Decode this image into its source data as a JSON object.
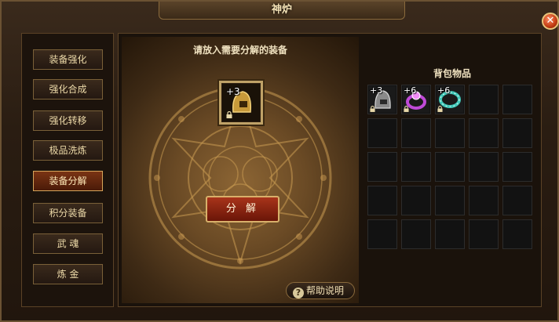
{
  "window": {
    "title": "神炉",
    "close_icon": "close-icon",
    "close_symbol": "✕"
  },
  "sidebar": {
    "items": [
      {
        "label": "装备强化",
        "active": false
      },
      {
        "label": "强化合成",
        "active": false
      },
      {
        "label": "强化转移",
        "active": false
      },
      {
        "label": "极品洗炼",
        "active": false
      },
      {
        "label": "装备分解",
        "active": true
      },
      {
        "label": "积分装备",
        "active": false
      },
      {
        "label": "武 魂",
        "active": false
      },
      {
        "label": "炼 金",
        "active": false
      }
    ]
  },
  "forge": {
    "prompt": "请放入需要分解的装备",
    "slot_item": {
      "level": "+3",
      "icon": "helmet-icon",
      "locked": true
    },
    "decompose_label": "分 解",
    "help_label": "帮助说明",
    "help_symbol": "?"
  },
  "bag": {
    "title": "背包物品",
    "items": [
      {
        "level": "+3",
        "icon": "helmet-icon",
        "locked": true
      },
      {
        "level": "+6",
        "icon": "ring-icon",
        "locked": true
      },
      {
        "level": "+6",
        "icon": "necklace-icon",
        "locked": true
      }
    ],
    "empty_slots": 22
  },
  "colors": {
    "accent": "#d8b06a",
    "active_tab": "#7a3414",
    "text": "#ecd9a8"
  }
}
